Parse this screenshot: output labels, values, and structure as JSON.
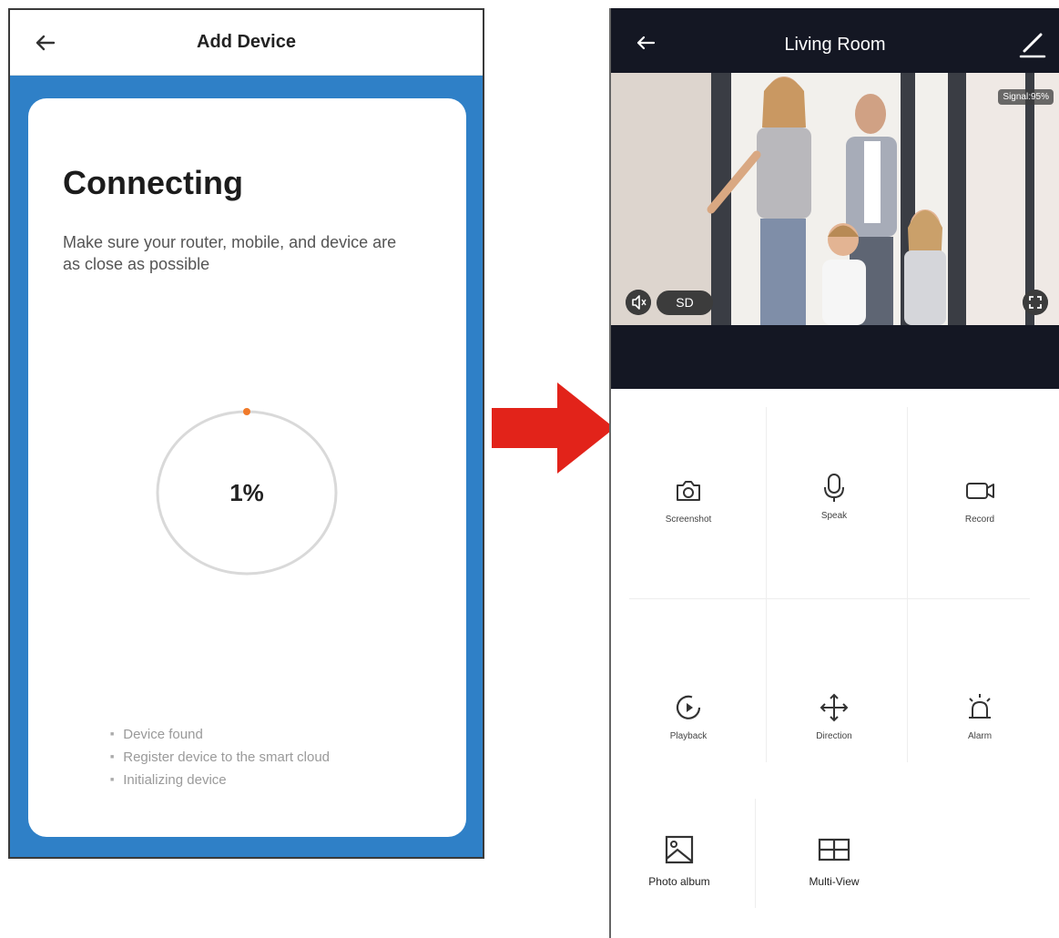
{
  "left_screen": {
    "header_title": "Add Device",
    "title": "Connecting",
    "description": "Make sure your router, mobile, and device are as close as possible",
    "progress_text": "1%",
    "progress_value": 0.01,
    "steps": [
      "Device found",
      "Register device to the smart cloud",
      "Initializing device"
    ],
    "colors": {
      "background": "#2f80c7",
      "progress_dot": "#f07a2a"
    }
  },
  "transition_arrow": {
    "color": "#e2231a",
    "icon": "arrow-right-icon"
  },
  "right_screen": {
    "header_title": "Living Room",
    "signal_badge": "Signal:95%",
    "quality_button": "SD",
    "controls": [
      {
        "label": "Screenshot",
        "icon": "camera-icon"
      },
      {
        "label": "Speak",
        "icon": "microphone-icon"
      },
      {
        "label": "Record",
        "icon": "video-camera-icon"
      },
      {
        "label": "Playback",
        "icon": "playback-icon"
      },
      {
        "label": "Direction",
        "icon": "move-arrows-icon"
      },
      {
        "label": "Alarm",
        "icon": "siren-icon"
      },
      {
        "label": "Photo album",
        "icon": "image-icon"
      },
      {
        "label": "Multi-View",
        "icon": "grid-icon"
      }
    ],
    "colors": {
      "header": "#141723"
    }
  }
}
